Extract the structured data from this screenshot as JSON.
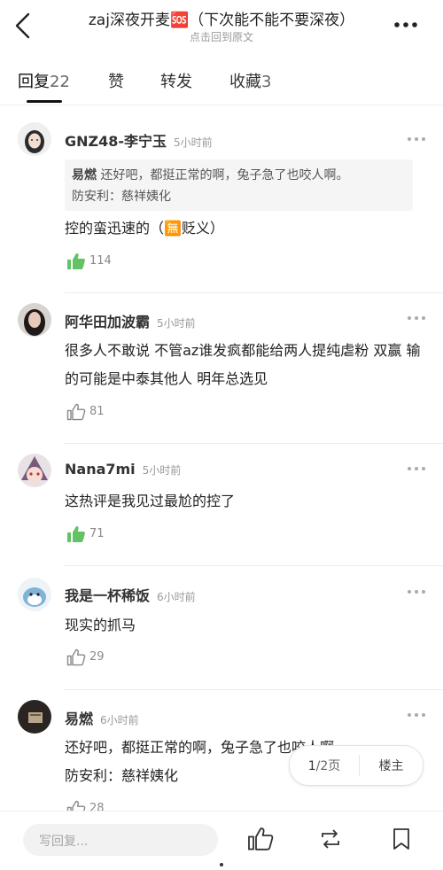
{
  "header": {
    "title": "zaj深夜开麦🆘（下次能不能不要深夜）",
    "subtitle": "点击回到原文",
    "back_icon": "chevron-left-icon",
    "more_icon": "more-horizontal-icon"
  },
  "tabs": [
    {
      "label": "回复",
      "count": "22"
    },
    {
      "label": "赞",
      "count": ""
    },
    {
      "label": "转发",
      "count": ""
    },
    {
      "label": "收藏",
      "count": "3"
    }
  ],
  "comments": [
    {
      "user": "GNZ48-李宁玉",
      "time": "5小时前",
      "quote_user": "易燃",
      "quote_line1": "还好吧，都挺正常的啊，兔子急了也咬人啊。",
      "quote_line2": "防安利：慈祥姨化",
      "text": "控的蛮迅速的（🈚贬义）",
      "likes": "114",
      "liked": true
    },
    {
      "user": "阿华田加波霸",
      "time": "5小时前",
      "text": "很多人不敢说 不管az谁发疯都能给两人提纯虐粉 双赢 输的可能是中泰其他人 明年总选见",
      "likes": "81",
      "liked": false
    },
    {
      "user": "Nana7mi",
      "time": "5小时前",
      "text": "这热评是我见过最尬的控了",
      "likes": "71",
      "liked": true
    },
    {
      "user": "我是一杯稀饭",
      "time": "6小时前",
      "text": "现实的抓马",
      "likes": "29",
      "liked": false
    },
    {
      "user": "易燃",
      "time": "6小时前",
      "text_line1": "还好吧，都挺正常的啊，兔子急了也咬人啊。",
      "text_line2": "防安利：慈祥姨化",
      "likes": "28",
      "liked": false
    }
  ],
  "pager": {
    "current": "1",
    "total_label": "/2页",
    "floor_label": "楼主"
  },
  "bottombar": {
    "reply_placeholder": "写回复...",
    "like_icon": "thumbs-up-icon",
    "repost_icon": "repost-icon",
    "bookmark_icon": "bookmark-icon"
  },
  "colors": {
    "like_active": "#62c265",
    "text": "#222222",
    "muted": "#999999"
  }
}
